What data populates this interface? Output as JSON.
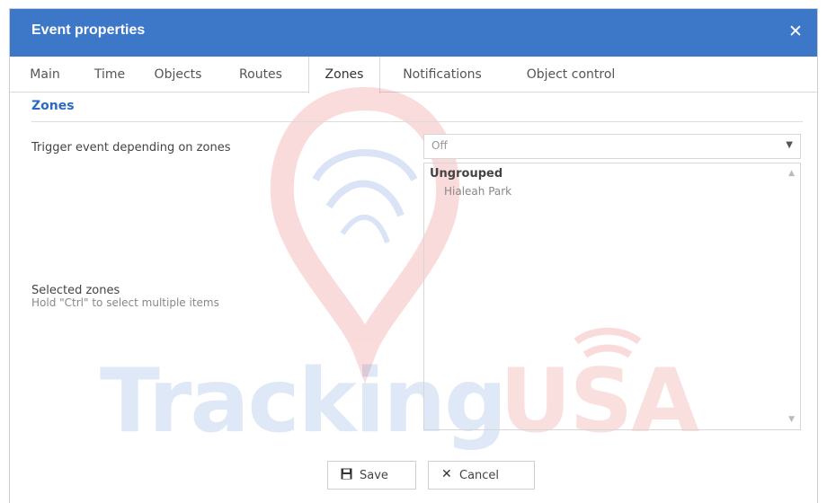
{
  "dialog": {
    "title": "Event properties",
    "close_glyph": "✕"
  },
  "tabs": [
    {
      "label": "Main"
    },
    {
      "label": "Time"
    },
    {
      "label": "Objects"
    },
    {
      "label": "Routes"
    },
    {
      "label": "Zones"
    },
    {
      "label": "Notifications"
    },
    {
      "label": "Object control"
    }
  ],
  "active_tab": "Zones",
  "section": {
    "title": "Zones"
  },
  "trigger": {
    "label": "Trigger event depending on zones",
    "value": "Off",
    "arrow": "▼"
  },
  "selected_zones": {
    "label": "Selected zones",
    "hint": "Hold \"Ctrl\" to select multiple items",
    "group": "Ungrouped",
    "options": [
      "Hialeah Park"
    ],
    "scroll_up": "▲",
    "scroll_down": "▼"
  },
  "watermark": {
    "text_left": "Tracking",
    "text_right": "USA",
    "color_left": "#3a6fd0",
    "color_right": "#e23b3b"
  },
  "buttons": {
    "save_label": "Save",
    "save_icon": "save-icon",
    "cancel_label": "Cancel",
    "cancel_icon": "close-icon"
  },
  "colors": {
    "titlebar": "#3d78c8",
    "accent": "#2b6bbd"
  }
}
